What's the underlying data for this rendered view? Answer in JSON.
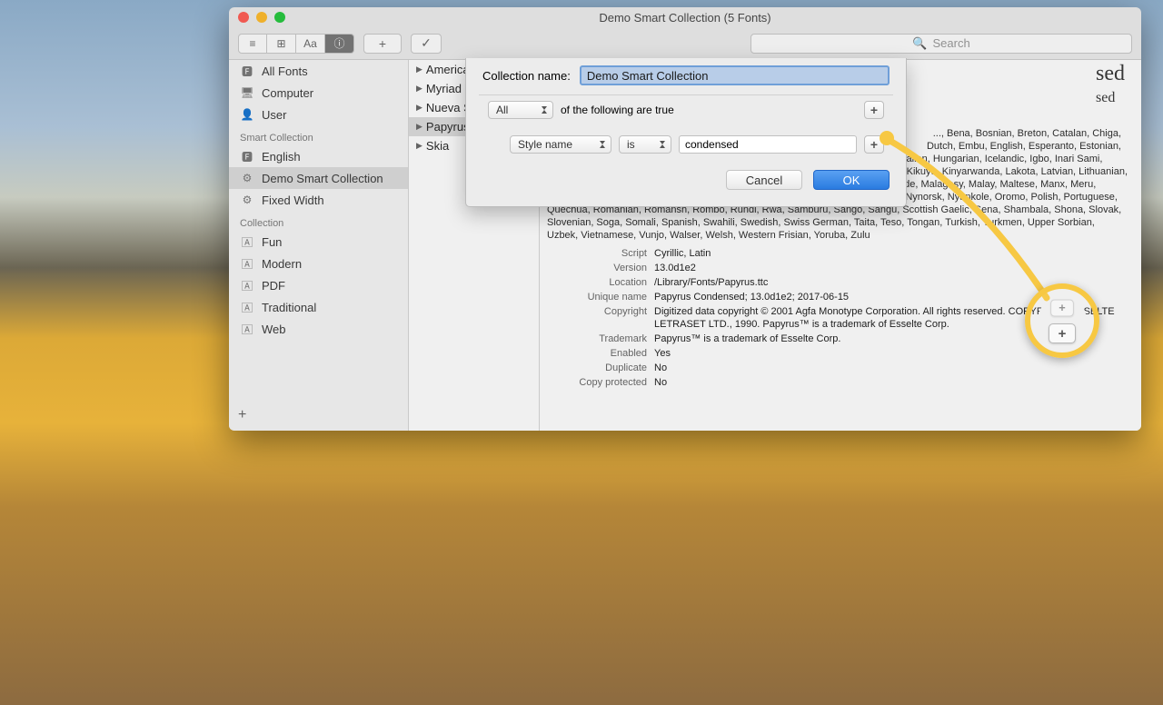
{
  "window_title": "Demo Smart Collection (5 Fonts)",
  "toolbar": {
    "view_list_label": "≡",
    "view_grid_label": "⊞",
    "view_aa_label": "Aa",
    "info_label": "ⓘ",
    "add_label": "+",
    "check_label": "✓",
    "search_placeholder": "Search"
  },
  "sidebar": {
    "groups": [
      {
        "items": [
          "All Fonts",
          "Computer",
          "User"
        ]
      },
      {
        "header": "Smart Collection",
        "items": [
          "English",
          "Demo Smart Collection",
          "Fixed Width"
        ],
        "selected": 1
      },
      {
        "header": "Collection",
        "items": [
          "Fun",
          "Modern",
          "PDF",
          "Traditional",
          "Web"
        ]
      }
    ],
    "add_label": "+"
  },
  "font_list": {
    "items": [
      "America",
      "Myriad P",
      "Nueva S",
      "Papyrus",
      "Skia"
    ],
    "selected": 3
  },
  "detail": {
    "title_big": "sed",
    "title_small": "sed",
    "languages": "Faroese, Filipino, Finnish, French, Friulian, Galician, Ganda, German, Gusii, Hawaiian, Hungarian, Icelandic, Igbo, Inari Sami, Indonesian, Irish, Italian, Jola-Fonyi, Kabuverdianu, Kalaallisut, Kalenjin, Kamba, Kikuyu, Kinyarwanda, Lakota, Latvian, Lithuanian, Lower Sorbian, Luo, Luxembourgish, Luyia, Machame, Makhuwa-Meetto, Makonde, Malagasy, Malay, Maltese, Manx, Meru, Morisyen, Nama, North Ndebele, Northern Sami, Norwegian Bokmål, Norwegian Nynorsk, Nyankole, Oromo, Polish, Portuguese, Quechua, Romanian, Romansh, Rombo, Rundi, Rwa, Samburu, Sango, Sangu, Scottish Gaelic, Sena, Shambala, Shona, Slovak, Slovenian, Soga, Somali, Spanish, Swahili, Swedish, Swiss German, Taita, Teso, Tongan, Turkish, Turkmen, Upper Sorbian, Uzbek, Vietnamese, Vunjo, Walser, Welsh, Western Frisian, Yoruba, Zulu",
    "languages_pre": "Dutch, Embu, English, Esperanto, Estonian,",
    "languages_pre2": "..., Bena, Bosnian, Breton, Catalan, Chiga,",
    "meta": {
      "Script": "Cyrillic, Latin",
      "Version": "13.0d1e2",
      "Location": "/Library/Fonts/Papyrus.ttc",
      "Unique name": "Papyrus Condensed; 13.0d1e2; 2017-06-15",
      "Copyright": "Digitized data copyright © 2001 Agfa Monotype Corporation. All rights reserved. COPYRIGHT ESSELTE LETRASET LTD., 1990. Papyrus™ is a trademark of Esselte Corp.",
      "Trademark": "Papyrus™ is a trademark of Esselte Corp.",
      "Enabled": "Yes",
      "Duplicate": "No",
      "Copy protected": "No"
    },
    "meta_keys": [
      "Script",
      "Version",
      "Location",
      "Unique name",
      "Copyright",
      "Trademark",
      "Enabled",
      "Duplicate",
      "Copy protected"
    ]
  },
  "sheet": {
    "name_label": "Collection name:",
    "name_value": "Demo Smart Collection",
    "match_mode": "All",
    "match_suffix": "of the following are true",
    "rule_attr": "Style name",
    "rule_op": "is",
    "rule_value": "condensed",
    "cancel": "Cancel",
    "ok": "OK"
  }
}
